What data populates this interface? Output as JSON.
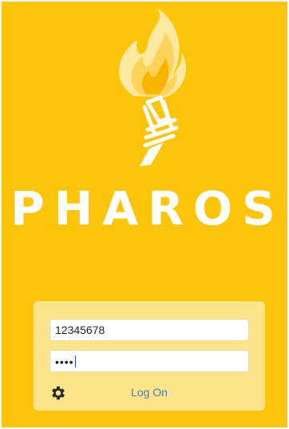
{
  "app": {
    "brand_name": "PHAROS",
    "logo_icon": "torch-icon"
  },
  "login": {
    "username_value": "12345678",
    "password_value": "••••",
    "settings_icon": "gear-icon",
    "logon_label": "Log On"
  },
  "colors": {
    "background": "#fcc40a",
    "card": "#fde38a",
    "link": "#3f7fc4",
    "brand_text": "#ffffff"
  }
}
